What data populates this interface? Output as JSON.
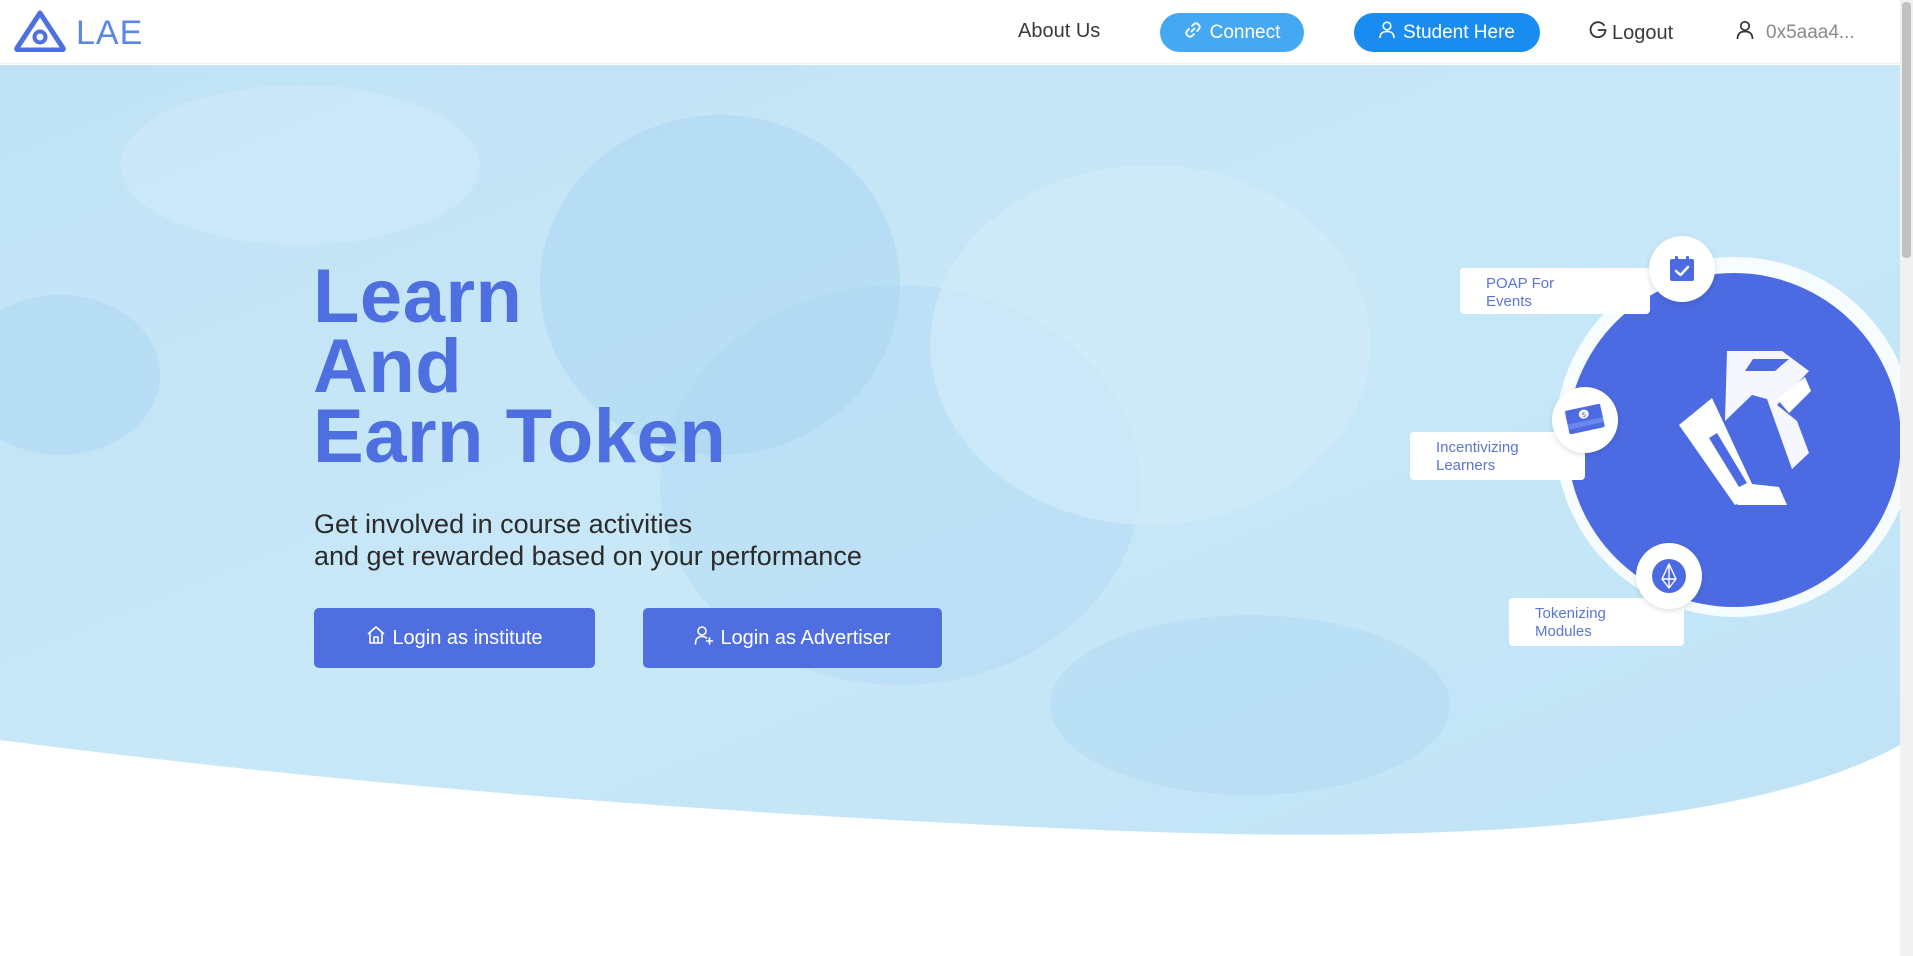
{
  "nav": {
    "brand": "LAE",
    "about": "About Us",
    "connect": "Connect",
    "student": "Student Here",
    "logout": "Logout",
    "account": "0x5aaa4..."
  },
  "hero": {
    "headline": [
      "Learn",
      "And",
      "Earn Token"
    ],
    "subtitle": [
      "Get involved in course activities",
      "and get rewarded based on your performance"
    ],
    "buttons": {
      "institute": "Login as institute",
      "advertiser": "Login as Advertiser"
    }
  },
  "features": [
    {
      "line1": "POAP For",
      "line2": "Events",
      "icon": "calendar-check-icon"
    },
    {
      "line1": "Incentivizing",
      "line2": "Learners",
      "icon": "money-stack-icon"
    },
    {
      "line1": "Tokenizing",
      "line2": "Modules",
      "icon": "eos-token-icon"
    }
  ],
  "colors": {
    "primary": "#4f6fe0",
    "connect": "#45a8f3",
    "student": "#1a8cf0",
    "brand": "#5a87e6",
    "hero_bg": "#c4e4f6"
  }
}
